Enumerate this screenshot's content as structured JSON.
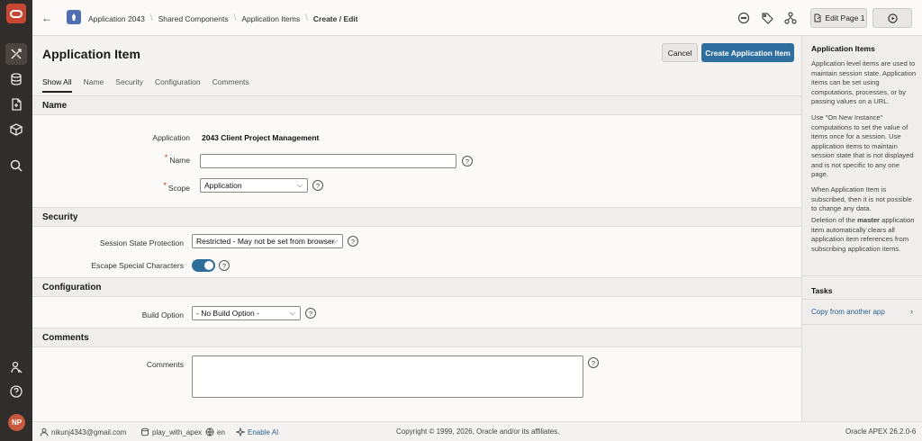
{
  "header": {
    "breadcrumbs": [
      "Application 2043",
      "Shared Components",
      "Application Items",
      "Create / Edit"
    ],
    "edit_page_label": "Edit Page 1"
  },
  "main": {
    "title": "Application Item",
    "cancel_label": "Cancel",
    "create_label": "Create Application Item",
    "tabs": [
      "Show All",
      "Name",
      "Security",
      "Configuration",
      "Comments"
    ],
    "active_tab": "Show All"
  },
  "sections": {
    "name": {
      "heading": "Name",
      "application_label": "Application",
      "application_value": "2043 Client Project Management",
      "name_label": "Name",
      "name_value": "",
      "scope_label": "Scope",
      "scope_value": "Application"
    },
    "security": {
      "heading": "Security",
      "ssp_label": "Session State Protection",
      "ssp_value": "Restricted - May not be set from browser",
      "escape_label": "Escape Special Characters",
      "escape_on": true
    },
    "configuration": {
      "heading": "Configuration",
      "build_label": "Build Option",
      "build_value": "- No Build Option -"
    },
    "comments": {
      "heading": "Comments",
      "comments_label": "Comments",
      "comments_value": ""
    }
  },
  "help_panel": {
    "title": "Application Items",
    "p1": "Application level items are used to maintain session state. Application items can be set using computations, processes, or by passing values on a URL.",
    "p2": "Use \"On New Instance\" computations to set the value of items once for a session. Use application items to maintain session state that is not displayed and is not specific to any one page.",
    "p3": "When Application Item is subscribed, then it is not possible to change any data.",
    "p4_pre": "Deletion of the ",
    "p4_bold": "master",
    "p4_post": " application item automatically clears all application item references from subscribing application items.",
    "tasks_title": "Tasks",
    "task_link": "Copy from another app"
  },
  "footer": {
    "user": "nikunj4343@gmail.com",
    "workspace": "play_with_apex",
    "language": "en",
    "enable_ai": "Enable AI",
    "copyright": "Copyright © 1999, 2026, Oracle and/or its affiliates.",
    "version": "Oracle APEX 26.2.0-6"
  },
  "user": {
    "initials": "NP"
  },
  "colors": {
    "rail": "#312d2a",
    "accent": "#2f6fa0",
    "logo": "#c74634",
    "avatar": "#c7593e"
  },
  "icons": [
    "oracle-logo-icon",
    "app-builder-icon",
    "sql-workshop-icon",
    "team-development-icon",
    "gallery-icon",
    "search-icon",
    "help-icon",
    "accessibility-icon",
    "comment-icon",
    "tag-icon",
    "shared-components-icon",
    "edit-page-icon",
    "run-icon"
  ]
}
